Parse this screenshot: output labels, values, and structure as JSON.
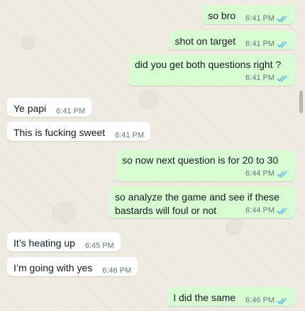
{
  "messages": [
    {
      "dir": "out",
      "text": "so bro",
      "time": "6:41 PM",
      "read": true
    },
    {
      "dir": "out",
      "text": "shot on target",
      "time": "6:41 PM",
      "read": true
    },
    {
      "dir": "out",
      "text": "did you get both questions right ?",
      "time": "6:41 PM",
      "read": true
    },
    {
      "dir": "in",
      "text": "Ye papi",
      "time": "6:41 PM"
    },
    {
      "dir": "in",
      "text": "This is fucking sweet",
      "time": "6:41 PM"
    },
    {
      "dir": "out",
      "text": "so now next question is for 20 to 30",
      "time": "6:44 PM",
      "read": true
    },
    {
      "dir": "out",
      "text_line1": "so analyze the game and see if these",
      "text_line2": "bastards will foul or not",
      "time": "6:44 PM",
      "read": true
    },
    {
      "dir": "in",
      "text": "It’s heating up",
      "time": "6:45 PM"
    },
    {
      "dir": "in",
      "text": "I’m going with yes",
      "time": "6:46 PM"
    },
    {
      "dir": "out",
      "text": "I did the same",
      "time": "6:46 PM",
      "read": true
    }
  ],
  "colors": {
    "outgoing_bubble": "#d9fdd3",
    "incoming_bubble": "#ffffff",
    "read_ticks": "#53bdeb",
    "timestamp": "#667781",
    "chat_background": "#efeae2"
  },
  "icons": {
    "read_receipt": "double-check-icon"
  }
}
